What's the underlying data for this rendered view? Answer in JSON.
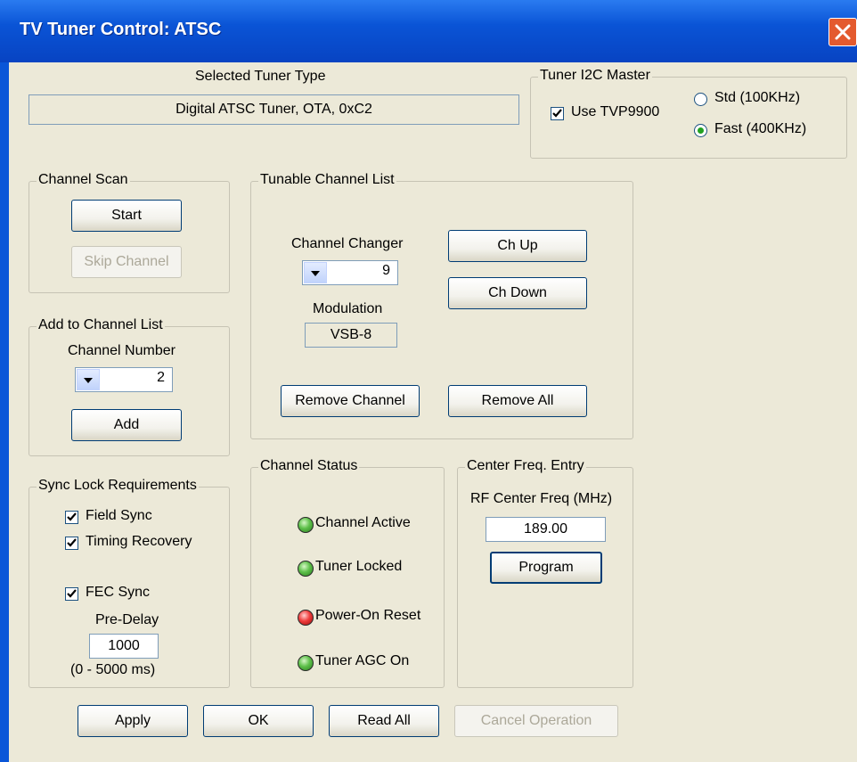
{
  "window": {
    "title": "TV Tuner Control: ATSC"
  },
  "tuner_type": {
    "label": "Selected Tuner Type",
    "value": "Digital ATSC Tuner, OTA, 0xC2"
  },
  "i2c_master": {
    "legend": "Tuner I2C Master",
    "use_tvp_label": "Use TVP9900",
    "use_tvp_checked": true,
    "std_label": "Std (100KHz)",
    "fast_label": "Fast (400KHz)",
    "selected": "fast"
  },
  "channel_scan": {
    "legend": "Channel Scan",
    "start_label": "Start",
    "skip_label": "Skip Channel"
  },
  "add_channel": {
    "legend": "Add to Channel List",
    "number_label": "Channel Number",
    "number_value": "2",
    "add_label": "Add"
  },
  "sync_lock": {
    "legend": "Sync Lock Requirements",
    "field_sync": "Field Sync",
    "timing_recovery": "Timing Recovery",
    "fec_sync": "FEC Sync",
    "pre_delay_label": "Pre-Delay",
    "pre_delay_value": "1000",
    "range_label": "(0 - 5000 ms)"
  },
  "tunable_list": {
    "legend": "Tunable Channel List",
    "changer_label": "Channel Changer",
    "channel_value": "9",
    "modulation_label": "Modulation",
    "modulation_value": "VSB-8",
    "ch_up": "Ch Up",
    "ch_down": "Ch Down",
    "remove_channel": "Remove Channel",
    "remove_all": "Remove All"
  },
  "channel_status": {
    "legend": "Channel Status",
    "items": [
      {
        "label": "Channel Active",
        "state": "green"
      },
      {
        "label": "Tuner Locked",
        "state": "green"
      },
      {
        "label": "Power-On Reset",
        "state": "red"
      },
      {
        "label": "Tuner AGC On",
        "state": "green"
      }
    ]
  },
  "center_freq": {
    "legend": "Center Freq. Entry",
    "label": "RF Center Freq (MHz)",
    "value": "189.00",
    "program_label": "Program"
  },
  "footer": {
    "apply": "Apply",
    "ok": "OK",
    "read_all": "Read All",
    "cancel": "Cancel Operation"
  },
  "colors": {
    "title_bar": "#0a54d6",
    "dialog_bg": "#ece9d8",
    "led_green": "#5ec04a",
    "led_red": "#f03c3c"
  }
}
